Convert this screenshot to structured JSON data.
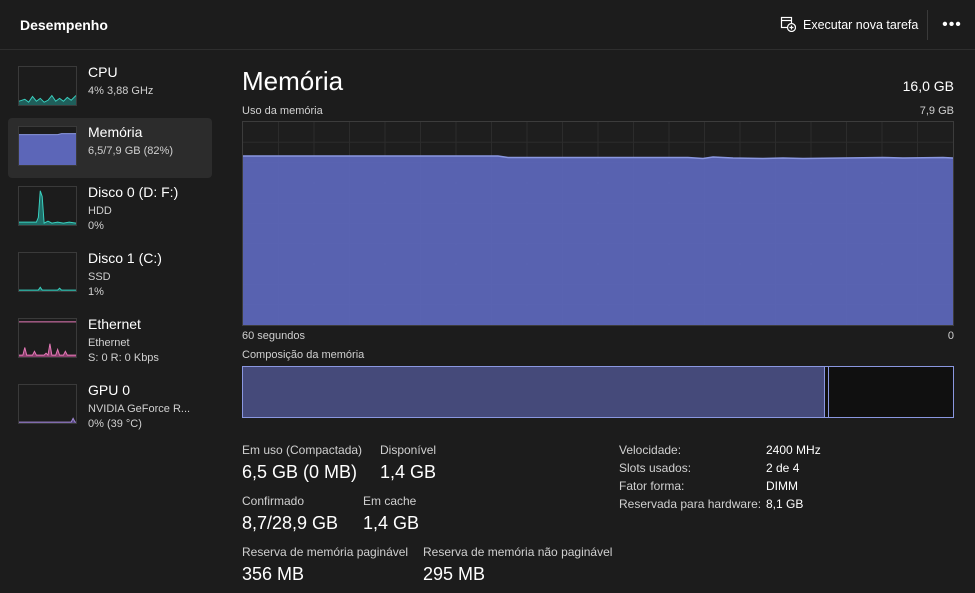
{
  "header": {
    "title": "Desempenho",
    "run_task_label": "Executar nova tarefa",
    "run_task_icon": "new-task-icon",
    "more_label": "•••"
  },
  "sidebar": {
    "items": [
      {
        "name": "CPU",
        "line1": "4% 3,88 GHz",
        "line2": "",
        "color": "#3ad1c0"
      },
      {
        "name": "Memória",
        "line1": "6,5/7,9 GB (82%)",
        "line2": "",
        "color": "#7b86d6",
        "selected": true
      },
      {
        "name": "Disco 0 (D: F:)",
        "line1": "HDD",
        "line2": "0%",
        "color": "#3ad1c0"
      },
      {
        "name": "Disco 1 (C:)",
        "line1": "SSD",
        "line2": "1%",
        "color": "#3ad1c0"
      },
      {
        "name": "Ethernet",
        "line1": "Ethernet",
        "line2": "S: 0 R: 0 Kbps",
        "color": "#e67ab8"
      },
      {
        "name": "GPU 0",
        "line1": "NVIDIA GeForce R...",
        "line2": "0% (39 °C)",
        "color": "#a58cd8"
      }
    ]
  },
  "main": {
    "title": "Memória",
    "total": "16,0 GB",
    "usage_label": "Uso da memória",
    "usage_max": "7,9 GB",
    "time_left": "60 segundos",
    "time_right": "0",
    "composition_label": "Composição da memória",
    "composition": {
      "in_use_fraction": 0.82,
      "standby_fraction": 0.0
    },
    "usage_history_fraction": 0.81,
    "accent_color": "#7b86d6",
    "stats": {
      "in_use_label": "Em uso (Compactada)",
      "in_use_value": "6,5 GB (0 MB)",
      "available_label": "Disponível",
      "available_value": "1,4 GB",
      "committed_label": "Confirmado",
      "committed_value": "8,7/28,9 GB",
      "cached_label": "Em cache",
      "cached_value": "1,4 GB",
      "paged_label": "Reserva de memória paginável",
      "paged_value": "356 MB",
      "nonpaged_label": "Reserva de memória não paginável",
      "nonpaged_value": "295 MB"
    },
    "details": [
      {
        "label": "Velocidade:",
        "value": "2400 MHz"
      },
      {
        "label": "Slots usados:",
        "value": "2 de 4"
      },
      {
        "label": "Fator forma:",
        "value": "DIMM"
      },
      {
        "label": "Reservada para hardware:",
        "value": "8,1 GB"
      }
    ]
  }
}
